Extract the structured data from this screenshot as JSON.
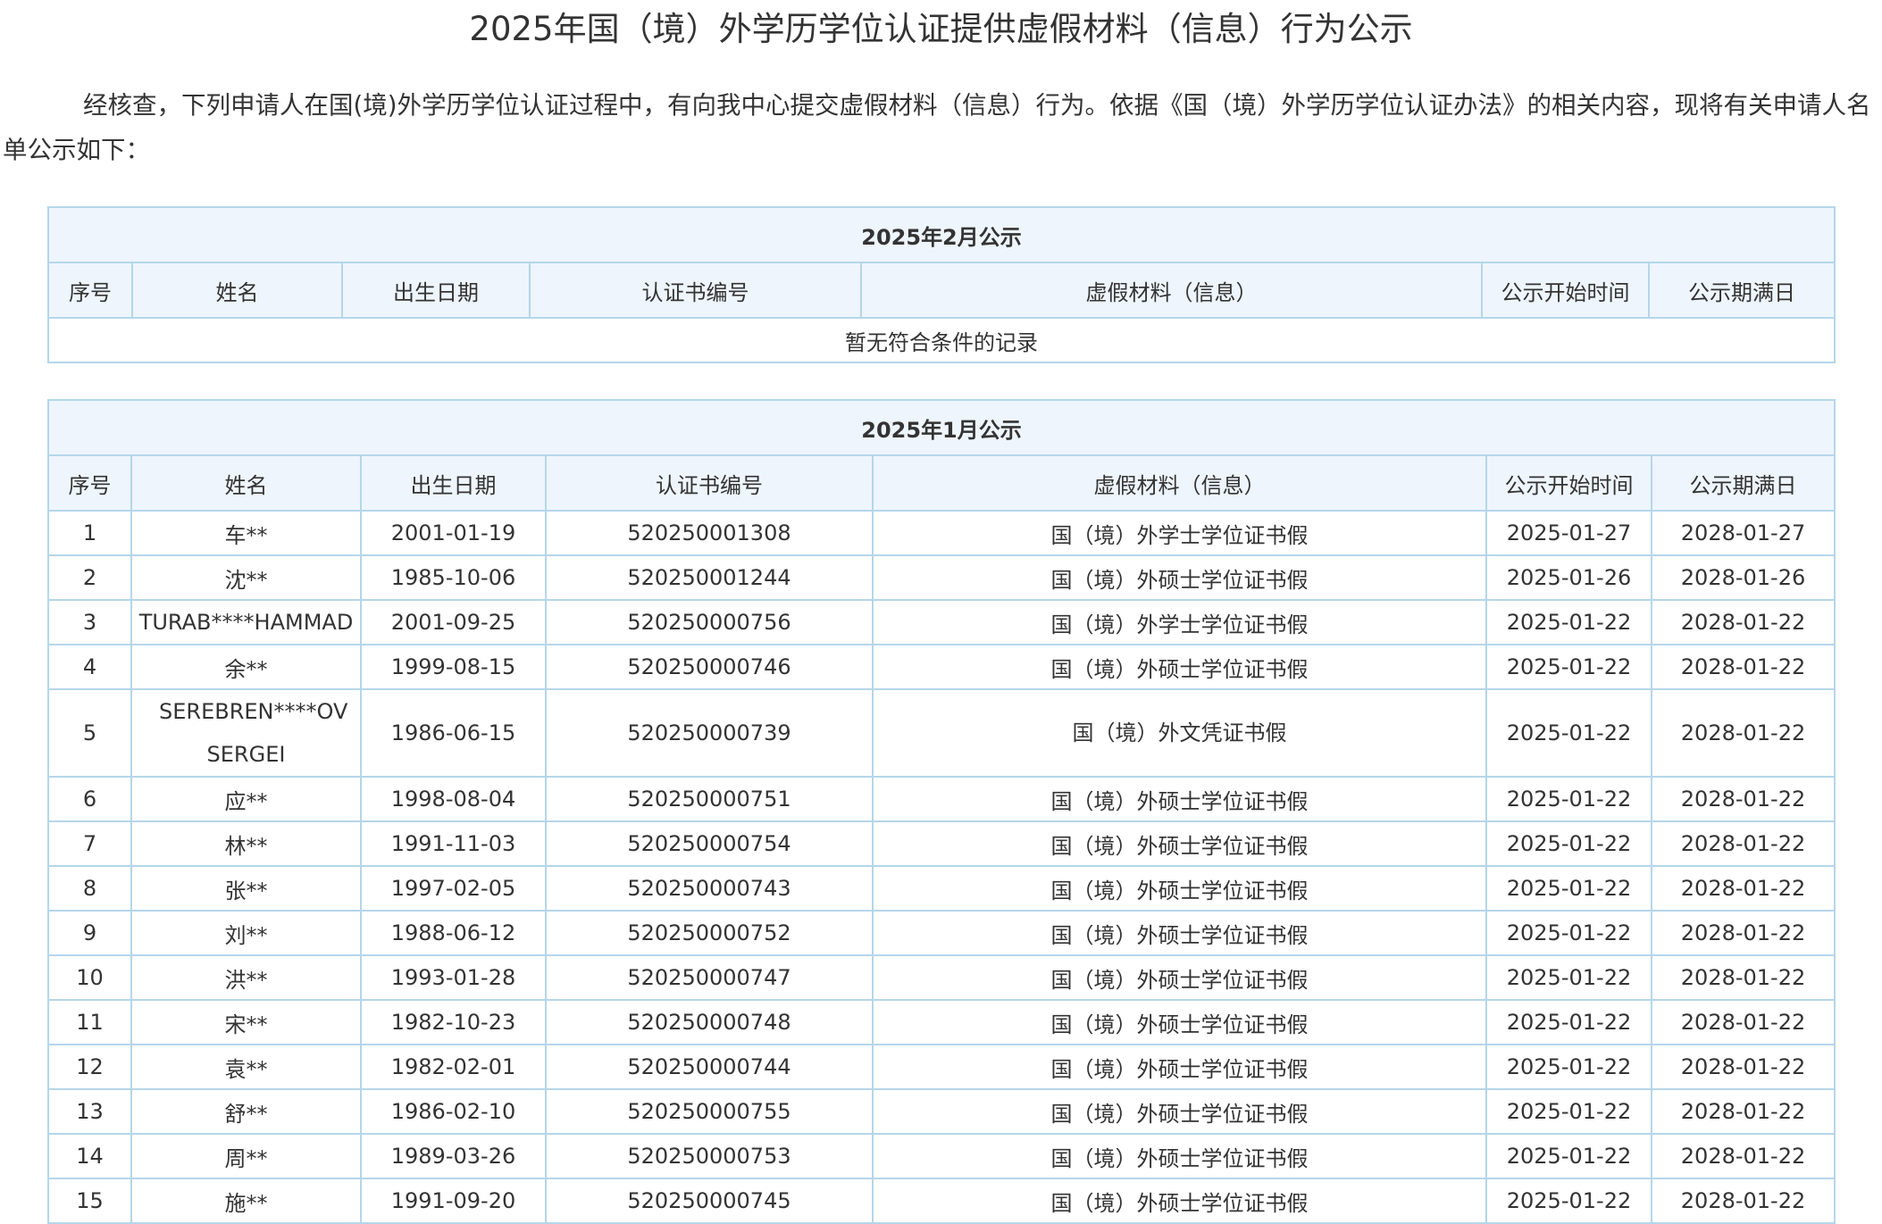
{
  "page": {
    "title": "2025年国（境）外学历学位认证提供虚假材料（信息）行为公示",
    "intro": "经核查，下列申请人在国(境)外学历学位认证过程中，有向我中心提交虚假材料（信息）行为。依据《国（境）外学历学位认证办法》的相关内容，现将有关申请人名单公示如下："
  },
  "columns": [
    "序号",
    "姓名",
    "出生日期",
    "认证书编号",
    "虚假材料（信息）",
    "公示开始时间",
    "公示期满日"
  ],
  "tables": [
    {
      "caption": "2025年2月公示",
      "empty_text": "暂无符合条件的记录",
      "rows": []
    },
    {
      "caption": "2025年1月公示",
      "rows": [
        {
          "no": "1",
          "name": "车**",
          "dob": "2001-01-19",
          "cert": "520250001308",
          "issue": "国（境）外学士学位证书假",
          "start": "2025-01-27",
          "end": "2028-01-27"
        },
        {
          "no": "2",
          "name": "沈**",
          "dob": "1985-10-06",
          "cert": "520250001244",
          "issue": "国（境）外硕士学位证书假",
          "start": "2025-01-26",
          "end": "2028-01-26"
        },
        {
          "no": "3",
          "name": "TURAB****HAMMAD",
          "dob": "2001-09-25",
          "cert": "520250000756",
          "issue": "国（境）外学士学位证书假",
          "start": "2025-01-22",
          "end": "2028-01-22"
        },
        {
          "no": "4",
          "name": "余**",
          "dob": "1999-08-15",
          "cert": "520250000746",
          "issue": "国（境）外硕士学位证书假",
          "start": "2025-01-22",
          "end": "2028-01-22"
        },
        {
          "no": "5",
          "name": "SEREBREN****OV SERGEI",
          "dob": "1986-06-15",
          "cert": "520250000739",
          "issue": "国（境）外文凭证书假",
          "start": "2025-01-22",
          "end": "2028-01-22"
        },
        {
          "no": "6",
          "name": "应**",
          "dob": "1998-08-04",
          "cert": "520250000751",
          "issue": "国（境）外硕士学位证书假",
          "start": "2025-01-22",
          "end": "2028-01-22"
        },
        {
          "no": "7",
          "name": "林**",
          "dob": "1991-11-03",
          "cert": "520250000754",
          "issue": "国（境）外硕士学位证书假",
          "start": "2025-01-22",
          "end": "2028-01-22"
        },
        {
          "no": "8",
          "name": "张**",
          "dob": "1997-02-05",
          "cert": "520250000743",
          "issue": "国（境）外硕士学位证书假",
          "start": "2025-01-22",
          "end": "2028-01-22"
        },
        {
          "no": "9",
          "name": "刘**",
          "dob": "1988-06-12",
          "cert": "520250000752",
          "issue": "国（境）外硕士学位证书假",
          "start": "2025-01-22",
          "end": "2028-01-22"
        },
        {
          "no": "10",
          "name": "洪**",
          "dob": "1993-01-28",
          "cert": "520250000747",
          "issue": "国（境）外硕士学位证书假",
          "start": "2025-01-22",
          "end": "2028-01-22"
        },
        {
          "no": "11",
          "name": "宋**",
          "dob": "1982-10-23",
          "cert": "520250000748",
          "issue": "国（境）外硕士学位证书假",
          "start": "2025-01-22",
          "end": "2028-01-22"
        },
        {
          "no": "12",
          "name": "袁**",
          "dob": "1982-02-01",
          "cert": "520250000744",
          "issue": "国（境）外硕士学位证书假",
          "start": "2025-01-22",
          "end": "2028-01-22"
        },
        {
          "no": "13",
          "name": "舒**",
          "dob": "1986-02-10",
          "cert": "520250000755",
          "issue": "国（境）外硕士学位证书假",
          "start": "2025-01-22",
          "end": "2028-01-22"
        },
        {
          "no": "14",
          "name": "周**",
          "dob": "1989-03-26",
          "cert": "520250000753",
          "issue": "国（境）外硕士学位证书假",
          "start": "2025-01-22",
          "end": "2028-01-22"
        },
        {
          "no": "15",
          "name": "施**",
          "dob": "1991-09-20",
          "cert": "520250000745",
          "issue": "国（境）外硕士学位证书假",
          "start": "2025-01-22",
          "end": "2028-01-22"
        }
      ]
    }
  ],
  "colors": {
    "border": "#b5d6ea",
    "header_bg": "#eef5fc",
    "text": "#333333"
  }
}
